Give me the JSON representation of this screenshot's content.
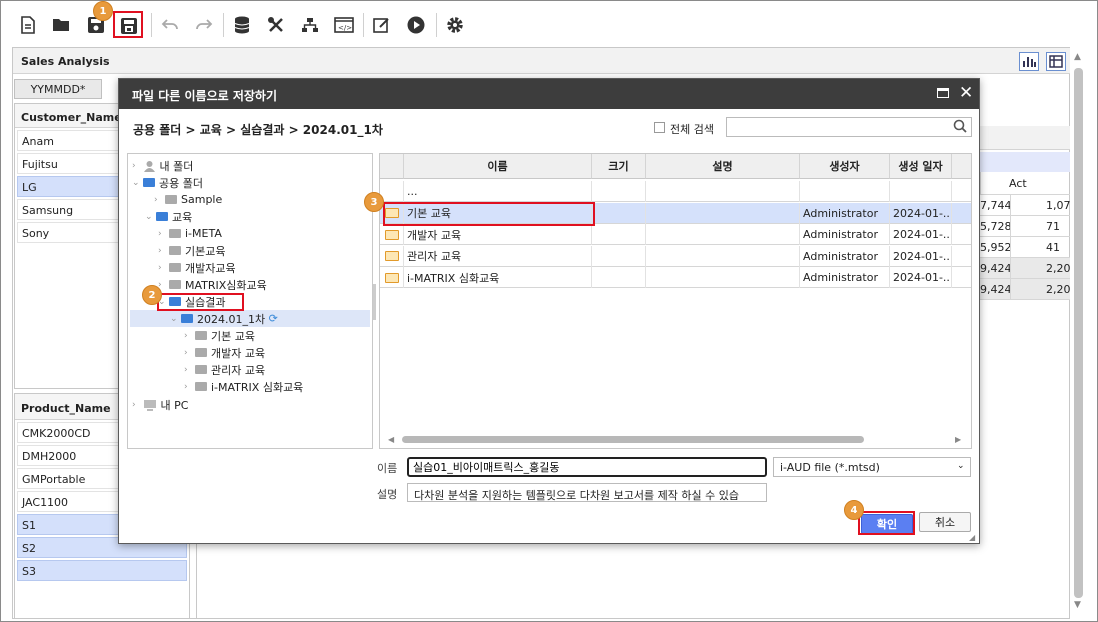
{
  "toolbar": {
    "markers": [
      "1",
      "2",
      "3",
      "4"
    ]
  },
  "sales": {
    "title": "Sales Analysis",
    "tab": "YYMMDD*",
    "customer_header": "Customer_Name",
    "customers": [
      "Anam",
      "Fujitsu",
      "LG",
      "Samsung",
      "Sony"
    ],
    "product_header": "Product_Name",
    "products": [
      "CMK2000CD",
      "DMH2000",
      "GMPortable",
      "JAC1100",
      "S1",
      "S2",
      "S3"
    ],
    "act_header": "Act",
    "num_a": [
      "7,744",
      "5,728",
      "5,952",
      "9,424",
      "9,424"
    ],
    "num_b": [
      "1,07",
      "71",
      "41",
      "2,20",
      "2,20"
    ]
  },
  "dialog": {
    "title": "파일 다른 이름으로 저장하기",
    "breadcrumb": "공용 폴더 > 교육 > 실습결과 > 2024.01_1차",
    "search_label": "전체 검색",
    "search_placeholder": "",
    "tree": [
      "내 폴더",
      "공용 폴더",
      "Sample",
      "교육",
      "i-META",
      "기본교육",
      "개발자교육",
      "MATRIX심화교육",
      "실습결과",
      "2024.01_1차",
      "기본 교육",
      "개발자 교육",
      "관리자 교육",
      "i-MATRIX 심화교육",
      "내 PC"
    ],
    "columns": [
      "이름",
      "크기",
      "설명",
      "생성자",
      "생성 일자"
    ],
    "rows": [
      {
        "name": "...",
        "creator": "",
        "date": ""
      },
      {
        "name": "기본 교육",
        "creator": "Administrator",
        "date": "2024-01-..."
      },
      {
        "name": "개발자 교육",
        "creator": "Administrator",
        "date": "2024-01-..."
      },
      {
        "name": "관리자 교육",
        "creator": "Administrator",
        "date": "2024-01-..."
      },
      {
        "name": "i-MATRIX 심화교육",
        "creator": "Administrator",
        "date": "2024-01-..."
      }
    ],
    "name_label": "이름",
    "name_value": "실습01_비아이매트릭스_홍길동",
    "filetype": "i-AUD file (*.mtsd)",
    "desc_label": "설명",
    "desc_value": "다차원 분석을 지원하는 템플릿으로 다차원 보고서를 제작 하실 수 있습",
    "confirm": "확인",
    "cancel": "취소"
  },
  "colors": {
    "marker": "#e89a3c",
    "highlight": "#e01020",
    "confirm": "#5b7ff2",
    "title_bar": "#3d3d3d"
  }
}
